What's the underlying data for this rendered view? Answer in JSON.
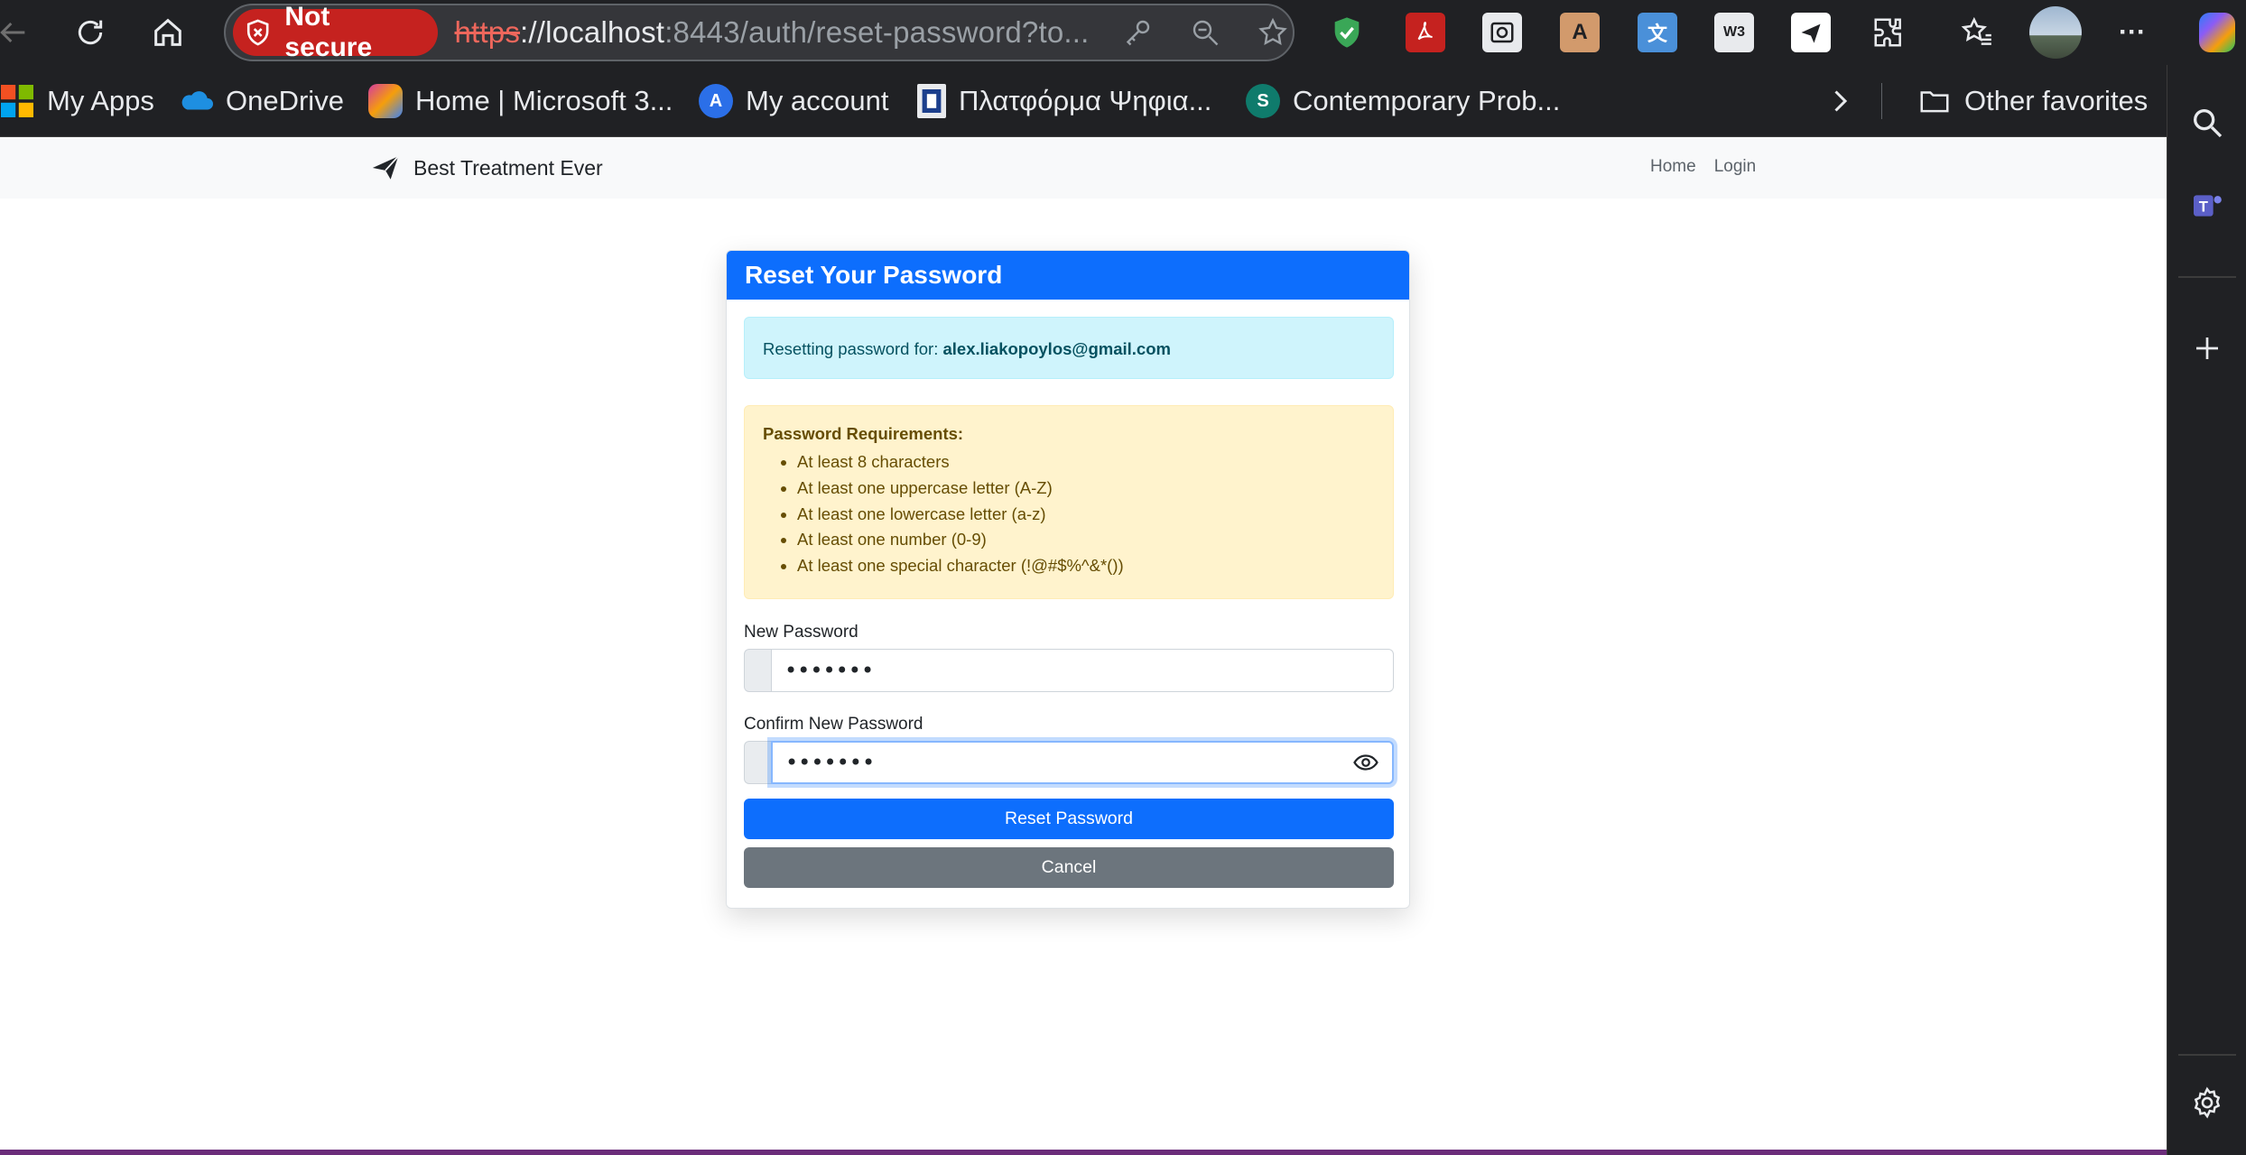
{
  "browser": {
    "not_secure_label": "Not secure",
    "url_scheme": "https",
    "url_rest_pre": "://localhost",
    "url_port_path": ":8443/auth/reset-password?to...",
    "bookmarks": [
      {
        "label": "My Apps",
        "icon": "ms-apps-icon"
      },
      {
        "label": "OneDrive",
        "icon": "onedrive-icon"
      },
      {
        "label": "Home | Microsoft 3...",
        "icon": "microsoft365-icon"
      },
      {
        "label": "My account",
        "icon": "account-icon"
      },
      {
        "label": "Πλατφόρμα Ψηφια...",
        "icon": "platform-icon"
      },
      {
        "label": "Contemporary Prob...",
        "icon": "sharepoint-icon"
      }
    ],
    "other_favorites": "Other favorites"
  },
  "navbar": {
    "brand": "Best Treatment Ever",
    "links": [
      "Home",
      "Login"
    ]
  },
  "card": {
    "title": "Reset Your Password",
    "info_prefix": "Resetting password for: ",
    "info_email": "alex.liakopoylos@gmail.com",
    "requirements_title": "Password Requirements:",
    "requirements": [
      "At least 8 characters",
      "At least one uppercase letter (A-Z)",
      "At least one lowercase letter (a-z)",
      "At least one number (0-9)",
      "At least one special character (!@#$%^&*())"
    ],
    "new_password_label": "New Password",
    "new_password_value": "•••••••",
    "confirm_password_label": "Confirm New Password",
    "confirm_password_value": "•••••••",
    "submit_label": "Reset Password",
    "cancel_label": "Cancel"
  },
  "colors": {
    "primary": "#0d6efd",
    "secondary": "#6c757d",
    "info_bg": "#cff4fc",
    "warning_bg": "#fff3cd",
    "not_secure": "#c5221f"
  }
}
